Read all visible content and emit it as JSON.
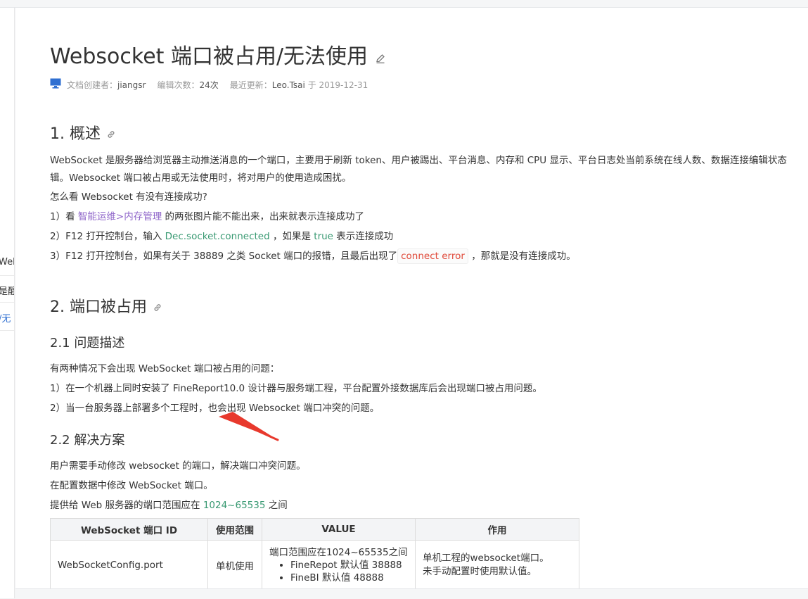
{
  "sidebar": {
    "clips": [
      "Web",
      "是醒",
      "/无"
    ]
  },
  "article": {
    "title": "Websocket 端口被占用/无法使用",
    "meta": {
      "creator_label": "文档创建者：",
      "creator": "jiangsr",
      "edits_label": "编辑次数：",
      "edits": "24次",
      "updated_label": "最近更新：",
      "updated_by": "Leo.Tsai",
      "updated_on": "于 2019-12-31"
    },
    "s1": {
      "heading": "1. 概述",
      "p1": "WebSocket 是服务器给浏览器主动推送消息的一个端口，主要用于刷新 token、用户被踢出、平台消息、内存和 CPU 显示、平台日志处当前系统在线人数、数据连接编辑状态",
      "p1b": "辑。Websocket 端口被占用或无法使用时，将对用户的使用造成困扰。",
      "p2": "怎么看 Websocket 有没有连接成功?",
      "l1_pre": "1）看 ",
      "l1_link": "智能运维>内存管理",
      "l1_post": " 的两张图片能不能出来，出来就表示连接成功了",
      "l2_pre": "2）F12 打开控制台，输入 ",
      "l2_code": "Dec.socket.connected",
      "l2_mid": " ，如果是 ",
      "l2_code2": "true",
      "l2_post": " 表示连接成功",
      "l3_pre": "3）F12 打开控制台，如果有关于 38889 之类 Socket 端口的报错，且最后出现了",
      "l3_code": "connect error",
      "l3_post": " ，那就是没有连接成功。"
    },
    "s2": {
      "heading": "2. 端口被占用",
      "sub1": "2.1 问题描述",
      "p1": "有两种情况下会出现 WebSocket 端口被占用的问题：",
      "l1": "1）在一个机器上同时安装了 FineReport10.0 设计器与服务端工程，平台配置外接数据库后会出现端口被占用问题。",
      "l2": "2）当一台服务器上部署多个工程时，也会出现 Websocket 端口冲突的问题。",
      "sub2": "2.2 解决方案",
      "p2": "用户需要手动修改 websocket 的端口，解决端口冲突问题。",
      "p3": "在配置数据中修改 WebSocket 端口。",
      "p4_pre": "提供给 Web 服务器的端口范围应在 ",
      "p4_code": "1024~65535",
      "p4_post": " 之间"
    },
    "table": {
      "headers": [
        "WebSocket 端口 ID",
        "使用范围",
        "VALUE",
        "作用"
      ],
      "row1": {
        "id": "WebSocketConfig.port",
        "scope": "单机使用",
        "value_intro": "端口范围应在1024~65535之间",
        "value_items": [
          "FineRepot 默认值 38888",
          "FineBI 默认值 48888"
        ],
        "purpose_1": "单机工程的websocket端口。",
        "purpose_2": "未手动配置时使用默认值。"
      }
    }
  },
  "colors": {
    "accent": "#2f6fd1",
    "link": "#8e64c9",
    "code_green": "#3a9a73",
    "code_red": "#e04a3a",
    "arrow": "#e8392d"
  }
}
